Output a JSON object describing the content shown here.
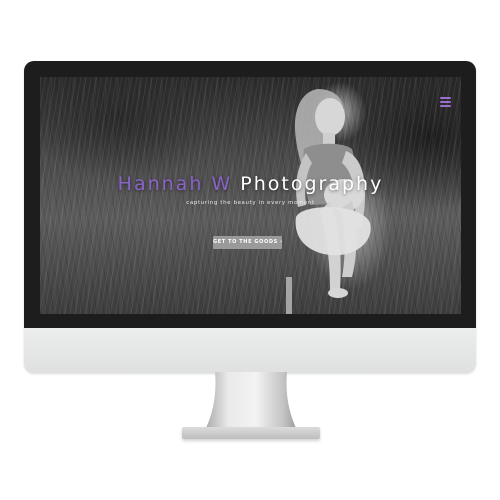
{
  "site": {
    "title_accent": "Hannah W",
    "title_main": "Photography",
    "tagline": "capturing the beauty in every moment",
    "cta_label": "GET TO THE GOODS ›",
    "menu_icon": "hamburger-menu-icon"
  },
  "colors": {
    "accent": "#8a63c9",
    "button_bg": "#9a9a9a",
    "bezel": "#1d1d1d",
    "chin": "#e6e7e7"
  }
}
